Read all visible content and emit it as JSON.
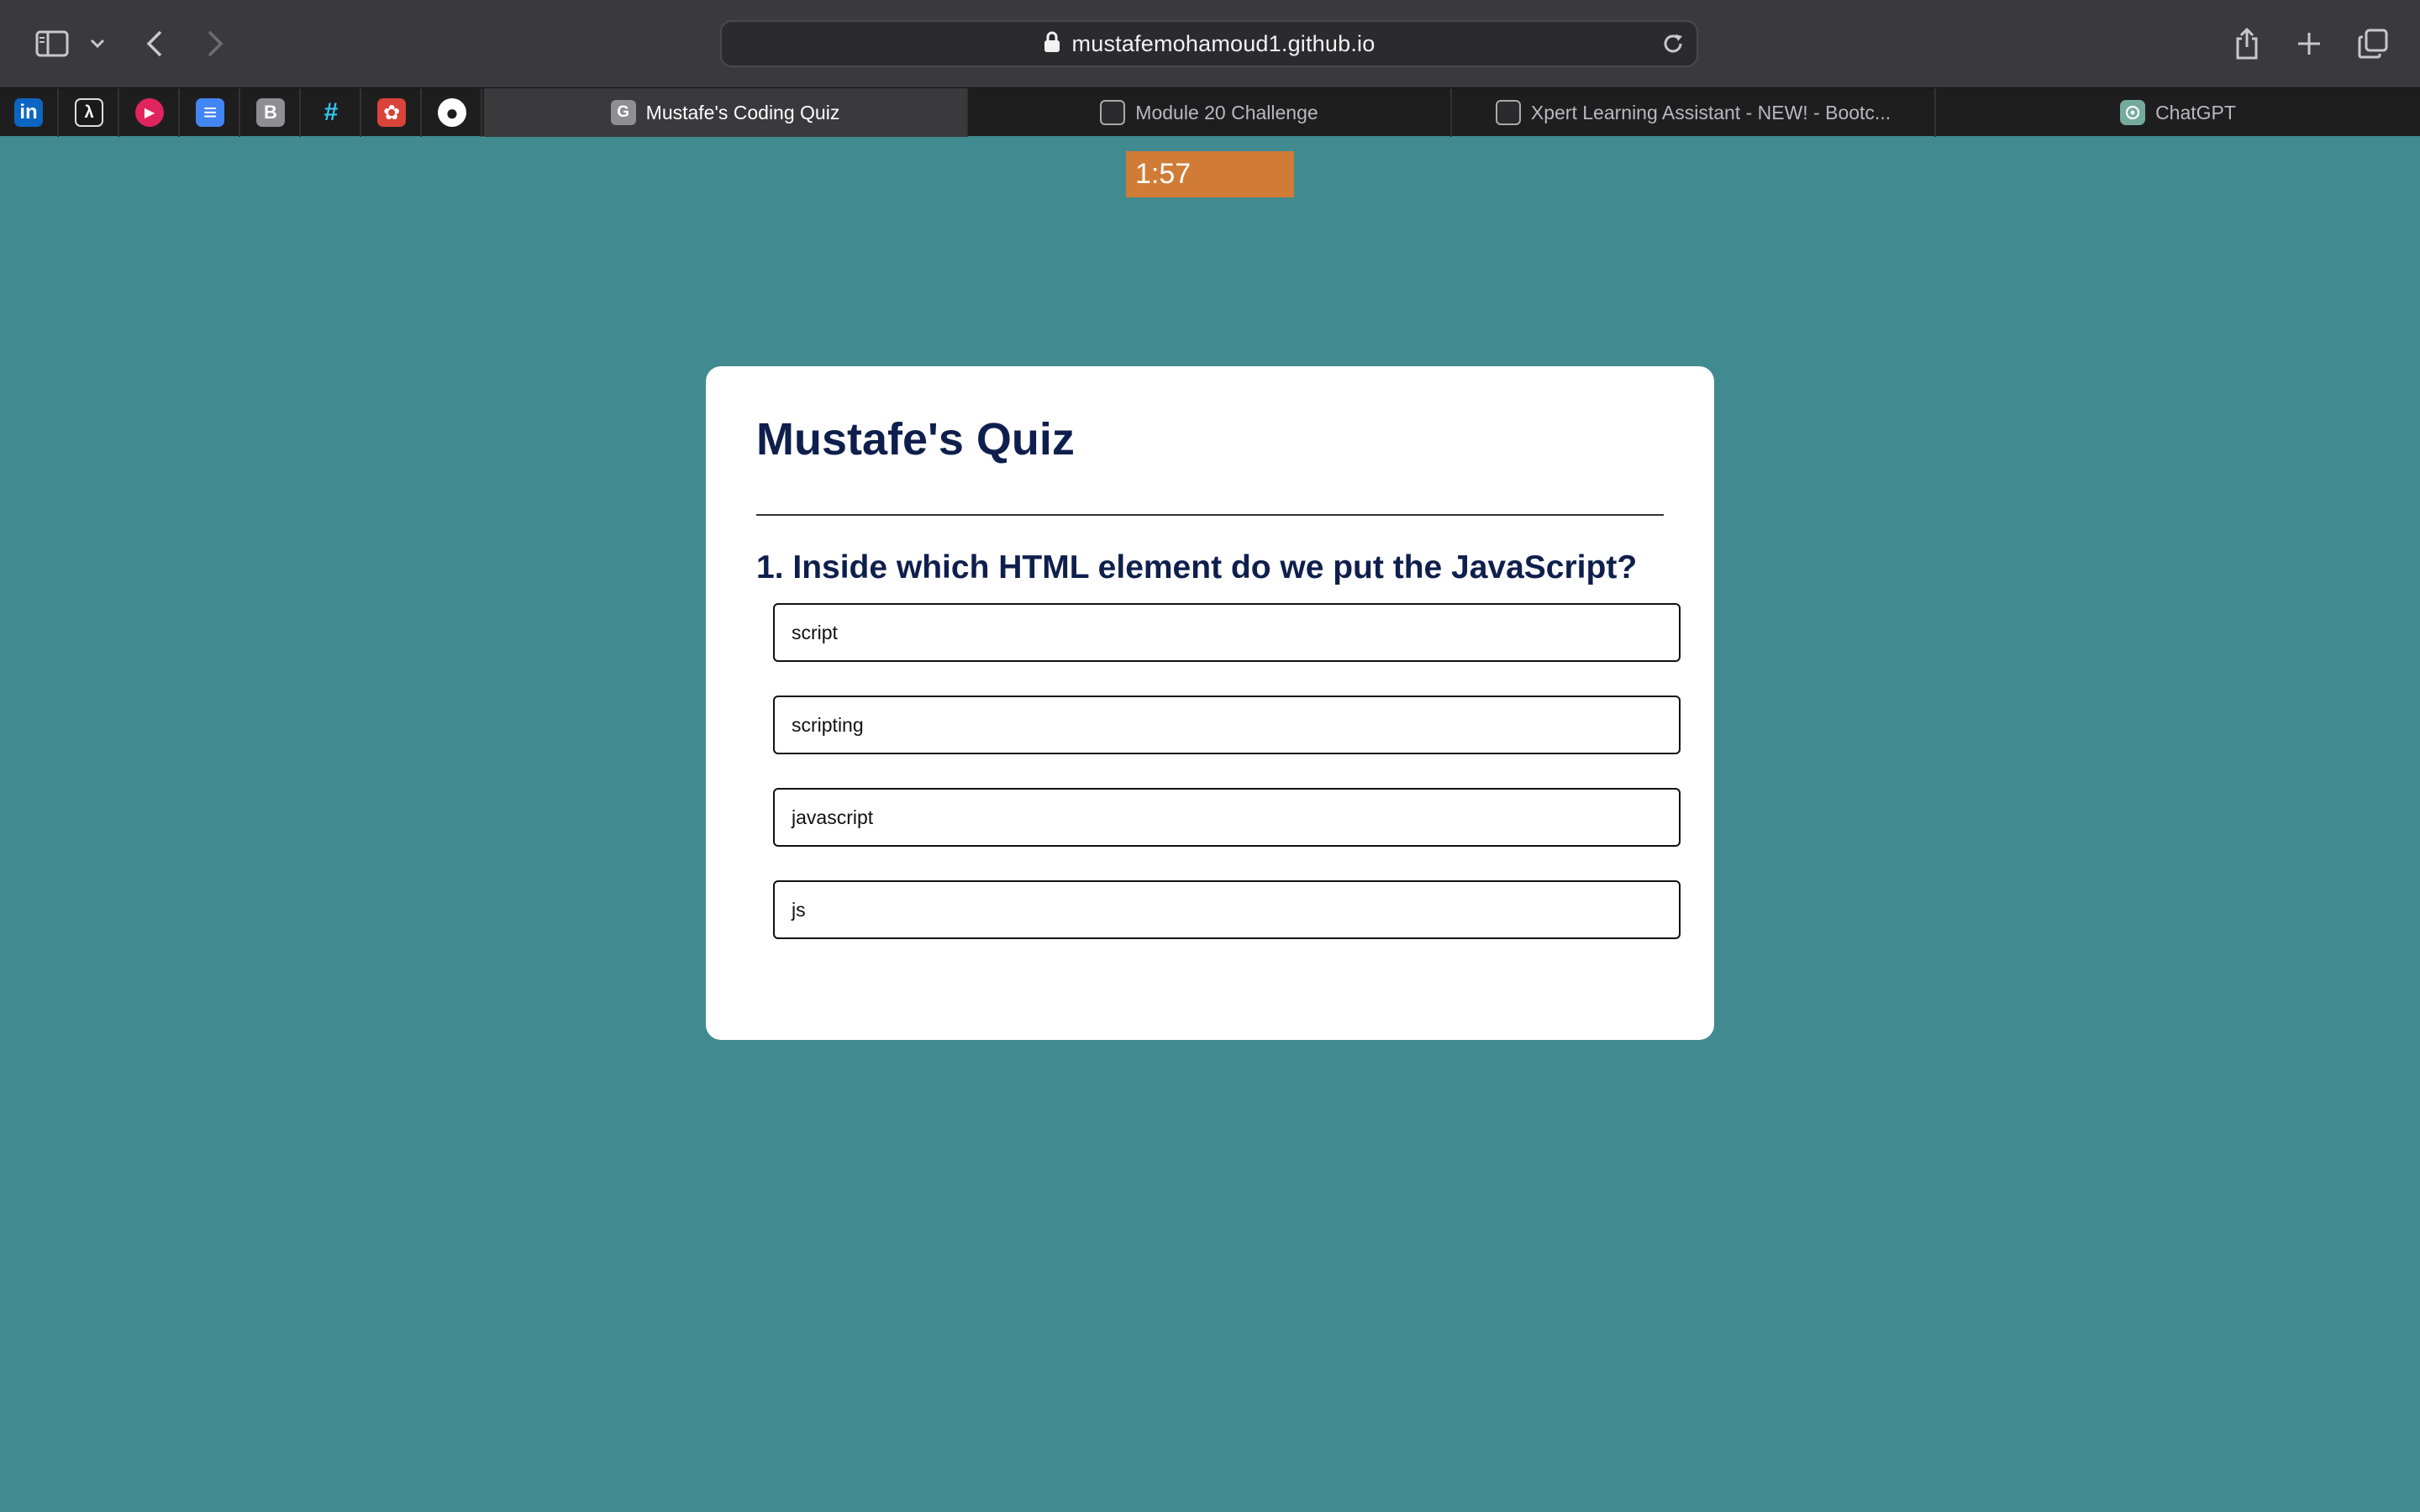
{
  "browser": {
    "url": "mustafemohamoud1.github.io",
    "tabs": [
      {
        "title": "Mustafe's Coding Quiz",
        "favicon_letter": "G",
        "active": true
      },
      {
        "title": "Module 20 Challenge",
        "active": false
      },
      {
        "title": "Xpert Learning Assistant - NEW! - Bootc...",
        "active": false
      },
      {
        "title": "ChatGPT",
        "active": false
      }
    ],
    "pinned_tabs": [
      {
        "icon": "linkedin-icon",
        "label": "in",
        "color": "#0a66c2"
      },
      {
        "icon": "aws-lambda-icon",
        "label": "λ",
        "color": "#1a1a1a"
      },
      {
        "icon": "media-play-icon",
        "label": "▶",
        "color": "#e0245e"
      },
      {
        "icon": "google-docs-icon",
        "label": "≡",
        "color": "#4285f4"
      },
      {
        "icon": "b-icon",
        "label": "B",
        "color": "#8e8e93"
      },
      {
        "icon": "slack-icon",
        "label": "#",
        "color": "#1e1e1f"
      },
      {
        "icon": "flower-app-icon",
        "label": "✿",
        "color": "#d9443a"
      },
      {
        "icon": "github-icon",
        "label": "●",
        "color": "#ffffff"
      }
    ]
  },
  "page": {
    "timer": "1:57",
    "title": "Mustafe's Quiz",
    "question": "1. Inside which HTML element do we put the JavaScript?",
    "answers": [
      "script",
      "scripting",
      "javascript",
      "js"
    ]
  },
  "colors": {
    "page_bg": "#418b90",
    "timer_bg": "#d07c37",
    "heading": "#0f1f4d"
  }
}
